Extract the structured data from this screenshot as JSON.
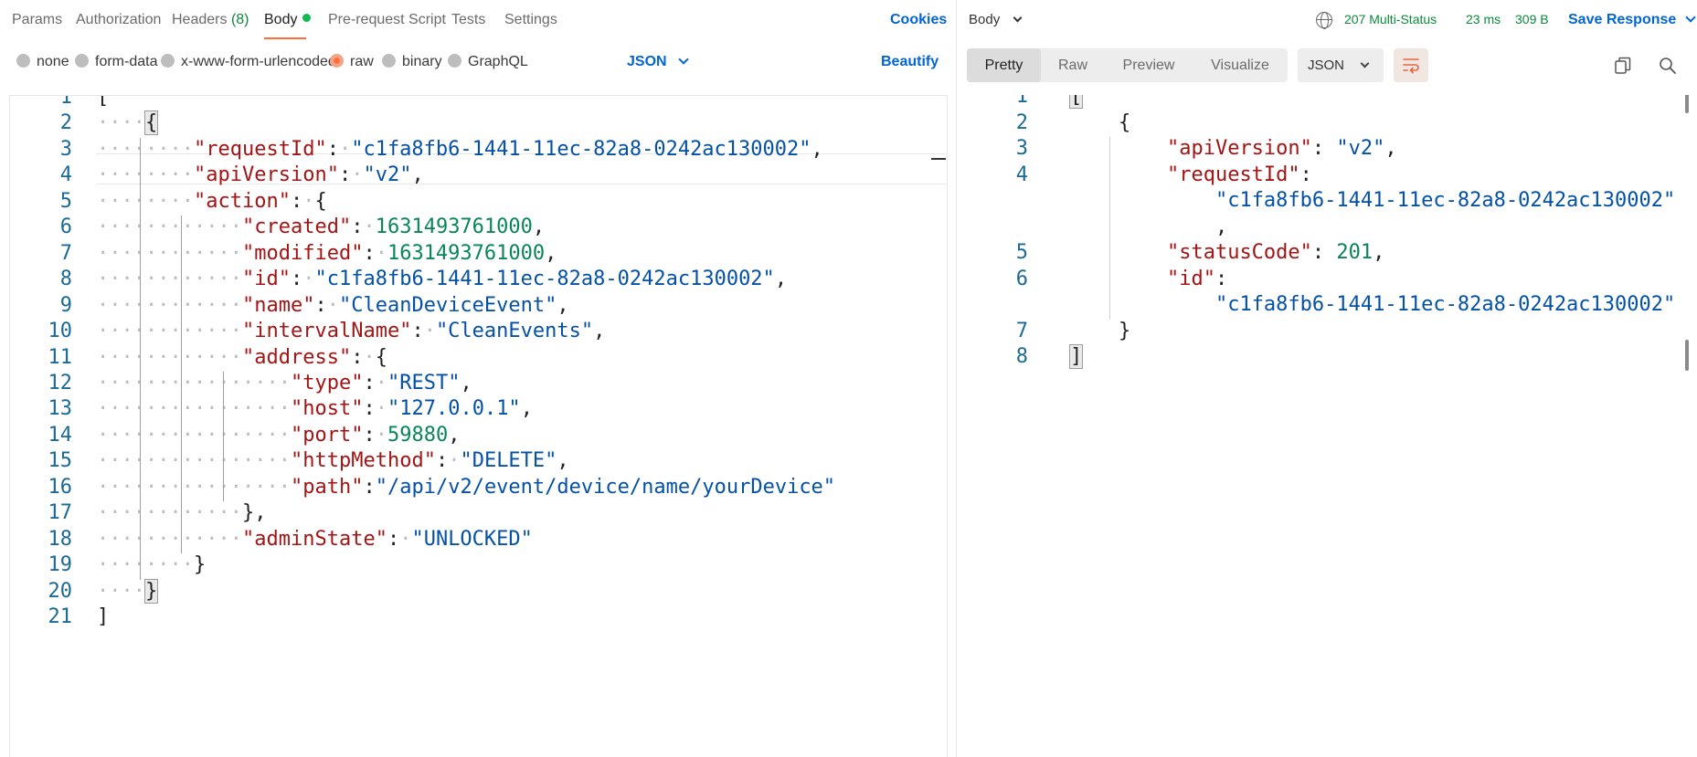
{
  "request_tabs": [
    {
      "label": "Params"
    },
    {
      "label": "Authorization"
    },
    {
      "label": "Headers",
      "count": "(8)"
    },
    {
      "label": "Body",
      "active": true
    },
    {
      "label": "Pre-request Script"
    },
    {
      "label": "Tests"
    },
    {
      "label": "Settings"
    }
  ],
  "cookies_label": "Cookies",
  "body_types": [
    "none",
    "form-data",
    "x-www-form-urlencoded",
    "raw",
    "binary",
    "GraphQL"
  ],
  "body_type_selected": "raw",
  "body_language": "JSON",
  "beautify_label": "Beautify",
  "request_code": [
    "[",
    "    {",
    "        \"requestId\": \"c1fa8fb6-1441-11ec-82a8-0242ac130002\",",
    "        \"apiVersion\": \"v2\",",
    "        \"action\": {",
    "            \"created\": 1631493761000,",
    "            \"modified\": 1631493761000,",
    "            \"id\": \"c1fa8fb6-1441-11ec-82a8-0242ac130002\",",
    "            \"name\": \"CleanDeviceEvent\",",
    "            \"intervalName\": \"CleanEvents\",",
    "            \"address\": {",
    "                \"type\": \"REST\",",
    "                \"host\": \"127.0.0.1\",",
    "                \"port\": 59880,",
    "                \"httpMethod\": \"DELETE\",",
    "                \"path\":\"/api/v2/event/device/name/yourDevice\"",
    "            },",
    "            \"adminState\": \"UNLOCKED\"",
    "        }",
    "    }",
    "]"
  ],
  "response": {
    "section_label": "Body",
    "status": "207 Multi-Status",
    "time": "23 ms",
    "size": "309 B",
    "save_label": "Save Response",
    "view_tabs": [
      "Pretty",
      "Raw",
      "Preview",
      "Visualize"
    ],
    "view_selected": "Pretty",
    "format": "JSON",
    "icons": [
      "globe-icon",
      "wrap-lines-icon",
      "copy-icon",
      "search-icon"
    ],
    "code_lines": [
      {
        "num": "1",
        "text": "["
      },
      {
        "num": "2",
        "text": "    {"
      },
      {
        "num": "3",
        "text": "        \"apiVersion\": \"v2\","
      },
      {
        "num": "4",
        "text": "        \"requestId\":"
      },
      {
        "num": "",
        "text": "            \"c1fa8fb6-1441-11ec-82a8-0242ac130002\""
      },
      {
        "num": "",
        "text": "            ,"
      },
      {
        "num": "5",
        "text": "        \"statusCode\": 201,"
      },
      {
        "num": "6",
        "text": "        \"id\":"
      },
      {
        "num": "",
        "text": "            \"c1fa8fb6-1441-11ec-82a8-0242ac130002\""
      },
      {
        "num": "7",
        "text": "    }"
      },
      {
        "num": "8",
        "text": "]"
      }
    ]
  },
  "colors": {
    "accent_orange": "#ff6c37",
    "link_blue": "#0265d2",
    "status_green": "#0a8a3a",
    "json_key": "#a31515",
    "json_string": "#0451a5",
    "json_number": "#098658",
    "line_number": "#1b6a96"
  }
}
